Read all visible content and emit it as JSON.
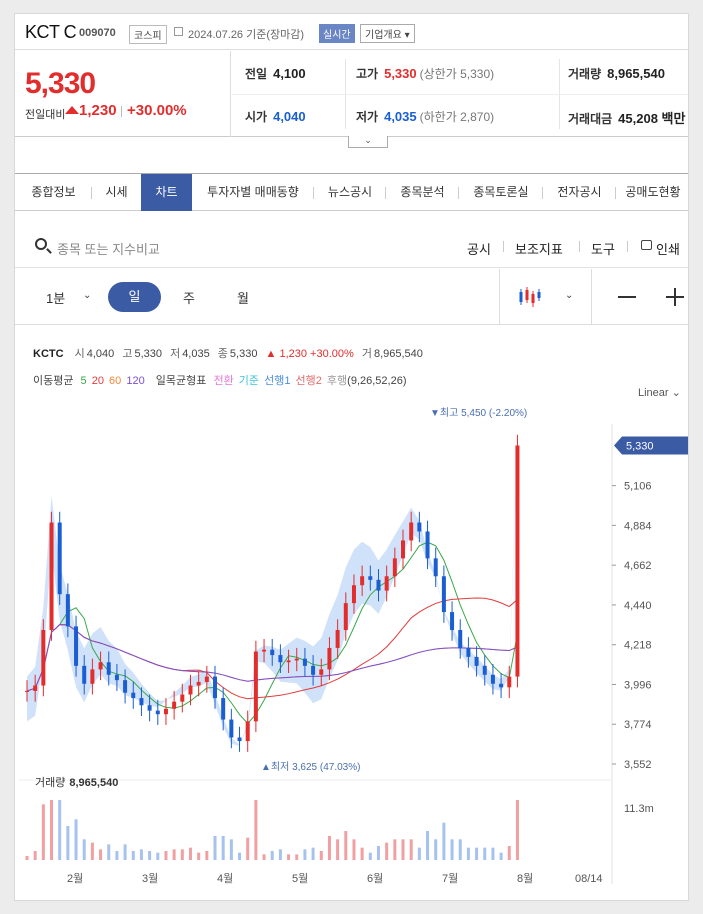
{
  "stock": {
    "name": "KCT C",
    "code": "009070",
    "market": "코스피",
    "date": "2024.07.26 기준(장마감)",
    "realtime": "실시간",
    "company_info": "기업개요",
    "price": "5,330",
    "change_label": "전일대비",
    "change": "1,230",
    "change_pct": "+30.00%",
    "prev_label": "전일",
    "prev": "4,100",
    "high_label": "고가",
    "high": "5,330",
    "upper_limit": "(상한가 5,330)",
    "volume_label": "거래량",
    "volume": "8,965,540",
    "open_label": "시가",
    "open": "4,040",
    "low_label": "저가",
    "low": "4,035",
    "lower_limit": "(하한가 2,870)",
    "amount_label": "거래대금",
    "amount": "45,208 백만"
  },
  "tabs": [
    {
      "label": "종합정보"
    },
    {
      "label": "시세"
    },
    {
      "label": "차트"
    },
    {
      "label": "투자자별 매매동향"
    },
    {
      "label": "뉴스공시"
    },
    {
      "label": "종목분석"
    },
    {
      "label": "종목토론실"
    },
    {
      "label": "전자공시"
    },
    {
      "label": "공매도현황"
    }
  ],
  "search": {
    "placeholder": "종목 또는 지수비교",
    "notice": "공시",
    "indicator": "보조지표",
    "tools": "도구",
    "print": "인쇄"
  },
  "periods": {
    "minute": "1분",
    "day": "일",
    "week": "주",
    "month": "월"
  },
  "legend": {
    "ticker": "KCTC",
    "o_label": "시",
    "o": "4,040",
    "h_label": "고",
    "h": "5,330",
    "l_label": "저",
    "l": "4,035",
    "c_label": "종",
    "c": "5,330",
    "chg": "1,230 +30.00%",
    "v_label": "거",
    "v": "8,965,540",
    "ma_label": "이동평균",
    "ma5": "5",
    "ma20": "20",
    "ma60": "60",
    "ma120": "120",
    "ich_label": "일목균형표",
    "ich_tenkan": "전환",
    "ich_kijun": "기준",
    "ich_span1": "선행1",
    "ich_span2": "선행2",
    "ich_chikou": "후행",
    "ich_params": "(9,26,52,26)",
    "scale": "Linear"
  },
  "chart_data": {
    "type": "line",
    "y_ticks": [
      3552,
      3774,
      3996,
      4218,
      4440,
      4662,
      4884,
      5106
    ],
    "y_tick_labels": [
      "3,552",
      "3,774",
      "3,996",
      "4,218",
      "4,440",
      "4,662",
      "4,884",
      "5,106"
    ],
    "current_price": 5330,
    "current_label": "5,330",
    "max_label": "▼최고 5,450 (-2.20%)",
    "min_label": "▲최저 3,625 (47.03%)",
    "x_labels": [
      "2월",
      "3월",
      "4월",
      "5월",
      "6월",
      "7월",
      "8월",
      "08/14"
    ],
    "volume_label": "거래량",
    "volume_value": "8,965,540",
    "volume_axis": "11.3m",
    "close": [
      3960,
      3990,
      4300,
      4900,
      4500,
      4320,
      4100,
      4000,
      4080,
      4120,
      4050,
      4020,
      3950,
      3920,
      3880,
      3850,
      3830,
      3860,
      3900,
      3940,
      3990,
      4010,
      4040,
      3920,
      3800,
      3700,
      3680,
      3790,
      4180,
      4190,
      4160,
      4120,
      4130,
      4140,
      4100,
      4050,
      4080,
      4200,
      4300,
      4450,
      4550,
      4600,
      4580,
      4520,
      4600,
      4700,
      4800,
      4900,
      4850,
      4700,
      4600,
      4400,
      4300,
      4200,
      4150,
      4100,
      4050,
      4000,
      3980,
      4040,
      5330
    ],
    "price_range": [
      3552,
      5450
    ],
    "ma20_color": "#e23b3b",
    "up_color": "#e22d2d",
    "down_color": "#1a5ed1"
  }
}
